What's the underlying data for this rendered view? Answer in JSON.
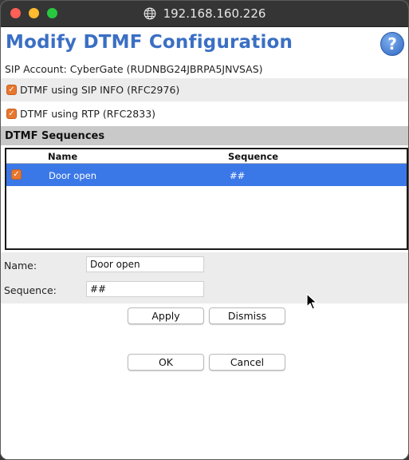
{
  "window": {
    "url": "192.168.160.226"
  },
  "page": {
    "title": "Modify DTMF Configuration",
    "help_symbol": "?",
    "sip_account": "SIP Account: CyberGate (RUDNBG24JBRPA5JNVSAS)"
  },
  "options": {
    "sip_info": {
      "label": "DTMF using SIP INFO (RFC2976)",
      "checked": true
    },
    "rtp": {
      "label": "DTMF using RTP (RFC2833)",
      "checked": true
    }
  },
  "sequences": {
    "title": "DTMF Sequences",
    "columns": {
      "name": "Name",
      "sequence": "Sequence"
    },
    "rows": [
      {
        "checked": true,
        "name": "Door open",
        "sequence": "##"
      }
    ]
  },
  "form": {
    "name_label": "Name:",
    "name_value": "Door open",
    "sequence_label": "Sequence:",
    "sequence_value": "##"
  },
  "buttons": {
    "apply": "Apply",
    "dismiss": "Dismiss",
    "ok": "OK",
    "cancel": "Cancel"
  },
  "colors": {
    "title_blue": "#3a6fc4",
    "checkbox_orange": "#e8772e",
    "selection_blue": "#3b78e7"
  }
}
